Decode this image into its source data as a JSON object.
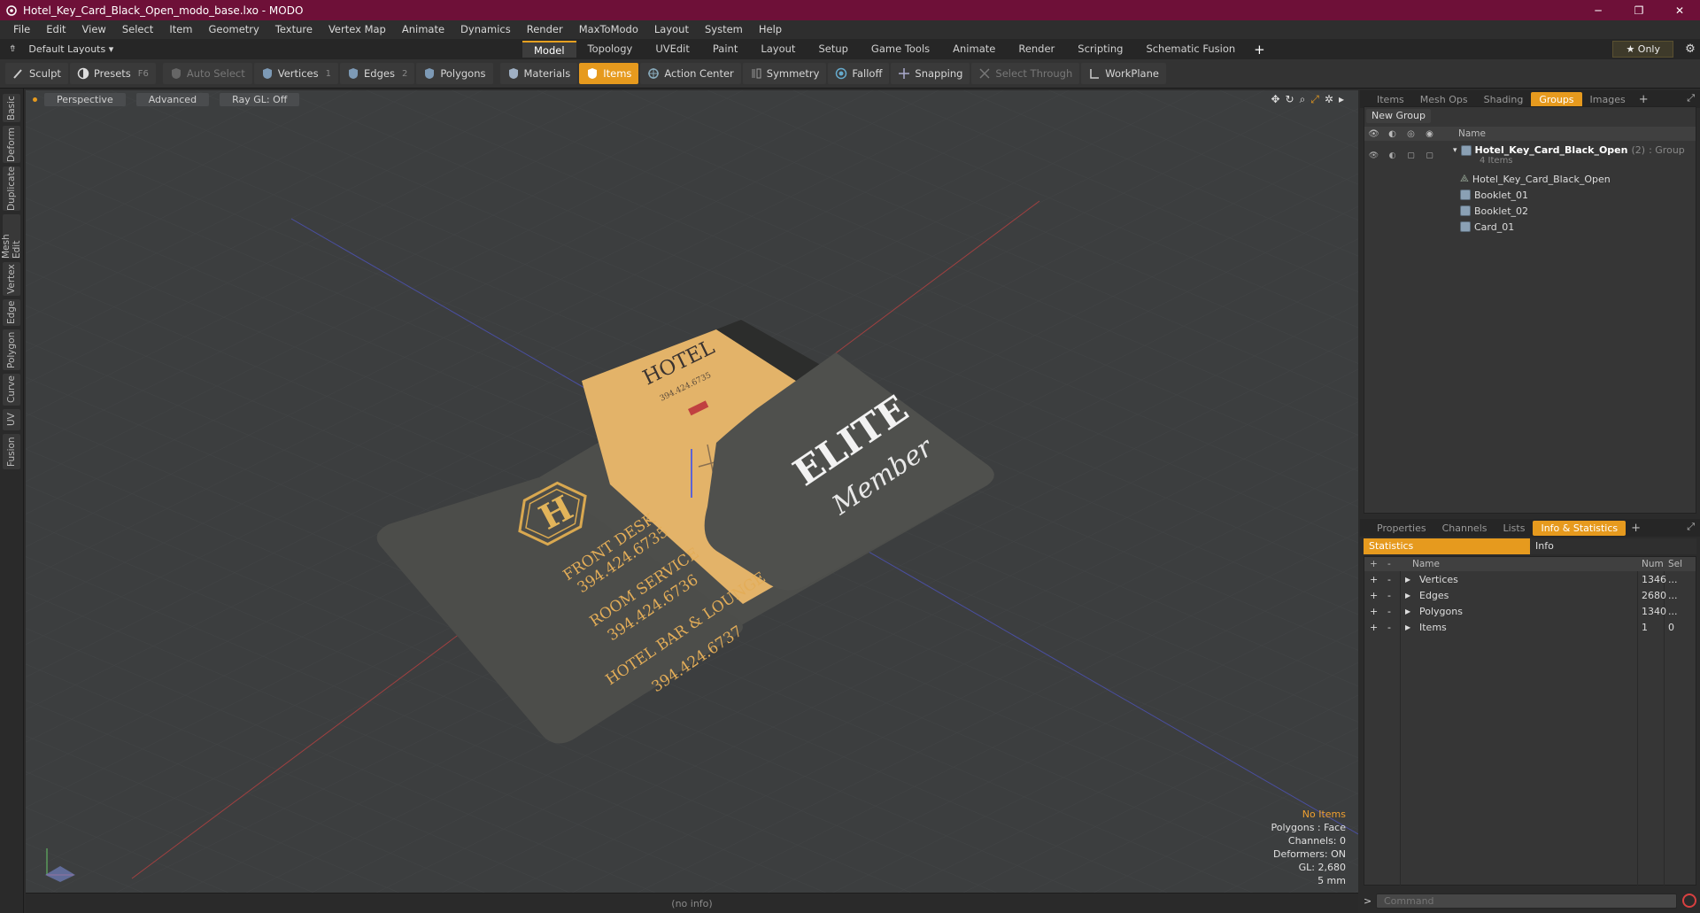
{
  "window": {
    "title": "Hotel_Key_Card_Black_Open_modo_base.lxo - MODO",
    "min": "─",
    "max": "❐",
    "close": "✕"
  },
  "menu": [
    "File",
    "Edit",
    "View",
    "Select",
    "Item",
    "Geometry",
    "Texture",
    "Vertex Map",
    "Animate",
    "Dynamics",
    "Render",
    "MaxToModo",
    "Layout",
    "System",
    "Help"
  ],
  "layouts": {
    "label": "Default Layouts ▾",
    "tabs": [
      "Model",
      "Topology",
      "UVEdit",
      "Paint",
      "Layout",
      "Setup",
      "Game Tools",
      "Animate",
      "Render",
      "Scripting",
      "Schematic Fusion"
    ],
    "active": "Model",
    "only": "★  Only"
  },
  "toolbar": {
    "sculpt": "Sculpt",
    "presets": "Presets",
    "presets_key": "F6",
    "auto_select": "Auto Select",
    "vertices": "Vertices",
    "vertices_key": "1",
    "edges": "Edges",
    "edges_key": "2",
    "polygons": "Polygons",
    "materials": "Materials",
    "items": "Items",
    "action_center": "Action Center",
    "symmetry": "Symmetry",
    "falloff": "Falloff",
    "snapping": "Snapping",
    "select_through": "Select Through",
    "workplane": "WorkPlane"
  },
  "left_tabs": [
    "Basic",
    "Deform",
    "Duplicate",
    "Mesh Edit",
    "Vertex",
    "Edge",
    "Polygon",
    "Curve",
    "UV",
    "Fusion"
  ],
  "viewport": {
    "perspective": "Perspective",
    "advanced": "Advanced",
    "raygl": "Ray GL: Off",
    "info": {
      "no_items": "No Items",
      "polygons": "Polygons : Face",
      "channels": "Channels: 0",
      "deformers": "Deformers: ON",
      "gl": "GL: 2,680",
      "unit": "5 mm"
    },
    "card_text": {
      "hotel": "HOTEL",
      "hotel_phone": "394.424.6735",
      "h": "H",
      "front_desk": "FRONT DESK",
      "phone1": "394.424.6735",
      "room_service": "ROOM SERVICE",
      "phone2": "394.424.6736",
      "bar": "HOTEL BAR & LOUNGE",
      "phone3": "394.424.6737",
      "elite": "ELITE",
      "member": "Member"
    }
  },
  "status": "(no info)",
  "groups_panel": {
    "tabs": [
      "Items",
      "Mesh Ops",
      "Shading",
      "Groups",
      "Images"
    ],
    "active": "Groups",
    "new_group": "New Group",
    "col_name": "Name",
    "root": {
      "name": "Hotel_Key_Card_Black_Open",
      "count": "(2)",
      "type": ": Group",
      "items": "4 Items"
    },
    "children": [
      "Hotel_Key_Card_Black_Open",
      "Booklet_01",
      "Booklet_02",
      "Card_01"
    ]
  },
  "stats_panel": {
    "tabs": [
      "Properties",
      "Channels",
      "Lists",
      "Info & Statistics"
    ],
    "active": "Info & Statistics",
    "subtabs": [
      "Statistics",
      "Info"
    ],
    "head": {
      "name": "Name",
      "num": "Num",
      "sel": "Sel"
    },
    "rows": [
      {
        "plus": "+",
        "minus": "-",
        "name": "Vertices",
        "num": "1346",
        "sel": "..."
      },
      {
        "plus": "+",
        "minus": "-",
        "name": "Edges",
        "num": "2680",
        "sel": "..."
      },
      {
        "plus": "+",
        "minus": "-",
        "name": "Polygons",
        "num": "1340",
        "sel": "..."
      },
      {
        "plus": "+",
        "minus": "-",
        "name": "Items",
        "num": "1",
        "sel": "0"
      }
    ],
    "command_placeholder": "Command"
  },
  "colors": {
    "accent": "#e69a1e",
    "titlebar": "#6e1038",
    "card_dark": "#4d4e4b",
    "card_gold": "#e3b369"
  }
}
